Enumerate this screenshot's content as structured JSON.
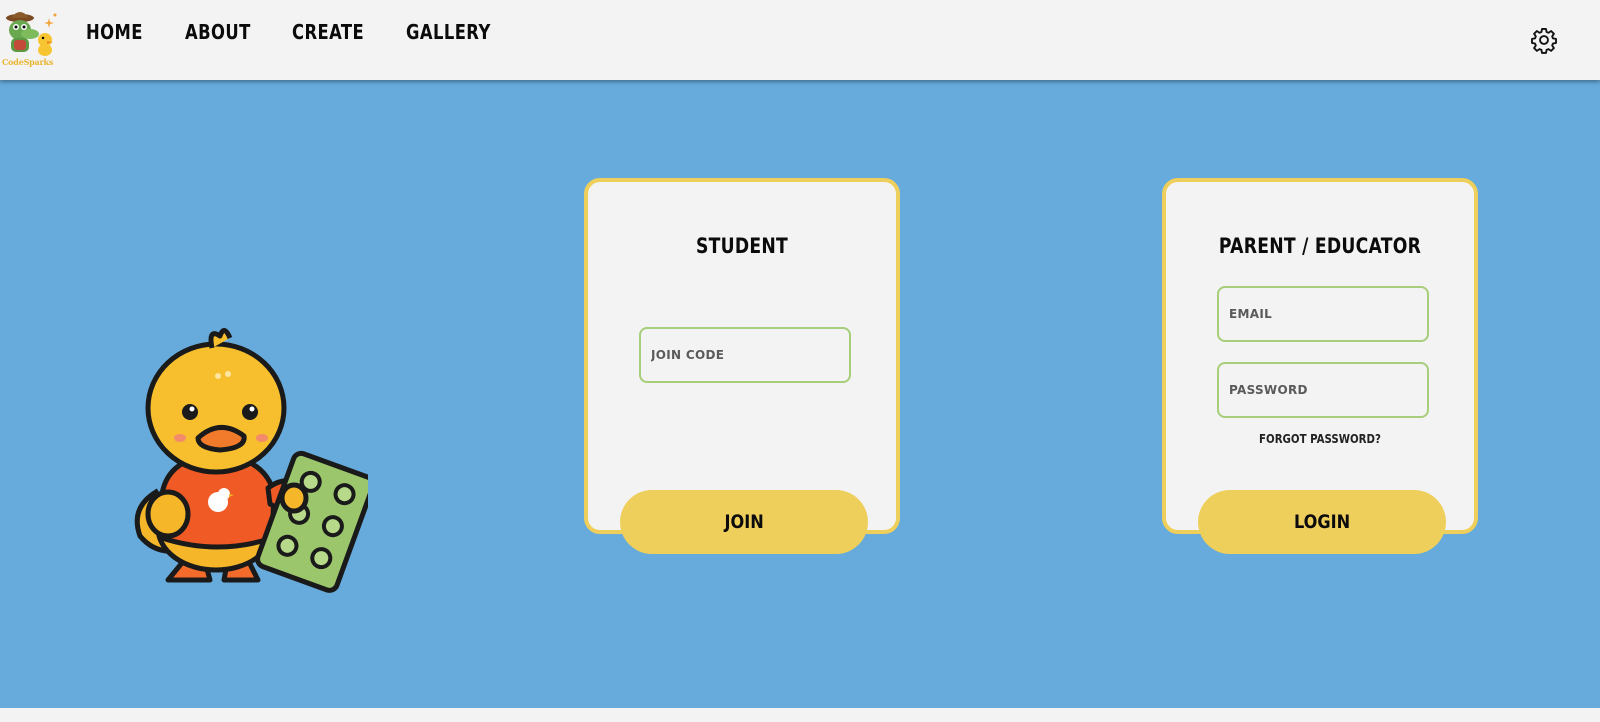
{
  "brand": {
    "logo_text": "CodeSparks"
  },
  "nav": {
    "items": [
      {
        "label": "HOME"
      },
      {
        "label": "ABOUT"
      },
      {
        "label": "CREATE"
      },
      {
        "label": "GALLERY"
      }
    ]
  },
  "settings": {
    "icon": "gear-icon"
  },
  "student": {
    "title": "STUDENT",
    "join_code_placeholder": "JOIN CODE",
    "join_code_value": "",
    "join_label": "JOIN"
  },
  "parent": {
    "title": "PARENT / EDUCATOR",
    "email_placeholder": "EMAIL",
    "email_value": "",
    "password_placeholder": "PASSWORD",
    "password_value": "",
    "forgot_label": "FORGOT PASSWORD?",
    "login_label": "LOGIN"
  },
  "colors": {
    "hero_bg": "#66abdb",
    "card_border": "#efcf5c",
    "button_bg": "#efcf5c",
    "field_border": "#a7ce7a",
    "topbar_bg": "#f3f3f3"
  }
}
